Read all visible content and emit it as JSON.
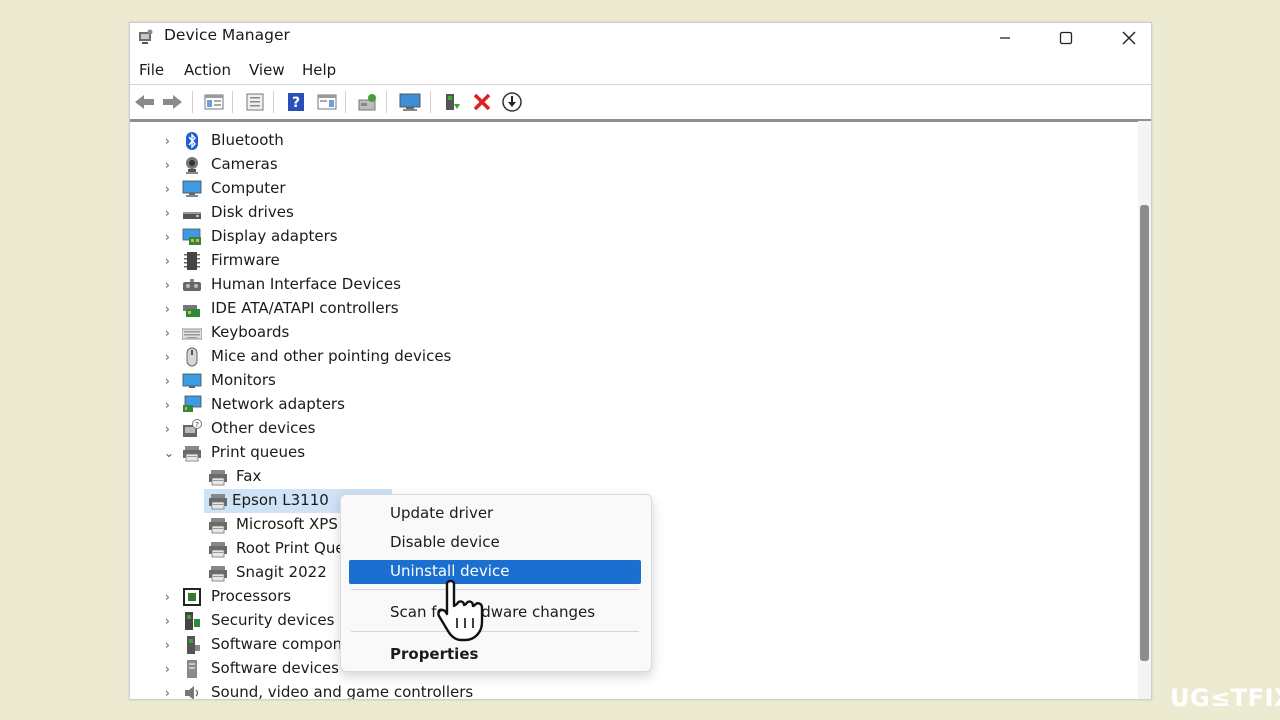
{
  "window": {
    "title": "Device Manager",
    "controls": [
      "minimize",
      "maximize",
      "close"
    ]
  },
  "menu": [
    "File",
    "Action",
    "View",
    "Help"
  ],
  "toolbar": {
    "icons": [
      "back-icon",
      "forward-icon",
      "console-tree-icon",
      "properties-icon",
      "help-icon",
      "action-pane-icon",
      "scan-hardware-icon",
      "monitor-icon",
      "update-driver-icon",
      "uninstall-icon",
      "download-icon"
    ]
  },
  "tree": {
    "items": [
      {
        "label": "Bluetooth",
        "icon": "bluetooth-icon",
        "expanded": false
      },
      {
        "label": "Cameras",
        "icon": "camera-icon",
        "expanded": false
      },
      {
        "label": "Computer",
        "icon": "computer-icon",
        "expanded": false
      },
      {
        "label": "Disk drives",
        "icon": "disk-icon",
        "expanded": false
      },
      {
        "label": "Display adapters",
        "icon": "display-adapter-icon",
        "expanded": false
      },
      {
        "label": "Firmware",
        "icon": "firmware-icon",
        "expanded": false
      },
      {
        "label": "Human Interface Devices",
        "icon": "hid-icon",
        "expanded": false
      },
      {
        "label": "IDE ATA/ATAPI controllers",
        "icon": "ide-icon",
        "expanded": false
      },
      {
        "label": "Keyboards",
        "icon": "keyboard-icon",
        "expanded": false
      },
      {
        "label": "Mice and other pointing devices",
        "icon": "mouse-icon",
        "expanded": false
      },
      {
        "label": "Monitors",
        "icon": "monitor-icon",
        "expanded": false
      },
      {
        "label": "Network adapters",
        "icon": "network-icon",
        "expanded": false
      },
      {
        "label": "Other devices",
        "icon": "other-devices-icon",
        "expanded": false
      },
      {
        "label": "Print queues",
        "icon": "printer-icon",
        "expanded": true
      },
      {
        "label": "Fax",
        "icon": "printer-icon",
        "child": true
      },
      {
        "label": "Epson L3110",
        "icon": "printer-icon",
        "child": true,
        "selected": true
      },
      {
        "label": "Microsoft XPS I",
        "icon": "printer-icon",
        "child": true
      },
      {
        "label": "Root Print Que",
        "icon": "printer-icon",
        "child": true
      },
      {
        "label": "Snagit 2022",
        "icon": "printer-icon",
        "child": true
      },
      {
        "label": "Processors",
        "icon": "processor-icon",
        "expanded": false
      },
      {
        "label": "Security devices",
        "icon": "security-icon",
        "expanded": false
      },
      {
        "label": "Software compone",
        "icon": "software-component-icon",
        "expanded": false
      },
      {
        "label": "Software devices",
        "icon": "software-device-icon",
        "expanded": false
      },
      {
        "label": "Sound, video and game controllers",
        "icon": "sound-icon",
        "expanded": false
      }
    ]
  },
  "context_menu": {
    "items": [
      {
        "label": "Update driver"
      },
      {
        "label": "Disable device"
      },
      {
        "label": "Uninstall device",
        "highlighted": true
      },
      {
        "label": "Scan for hardware changes"
      },
      {
        "label": "Properties",
        "bold": true
      }
    ]
  },
  "watermark": "UG≤TFIX",
  "colors": {
    "background": "#ecebd2",
    "selection": "#cfe3f6",
    "menu_highlight": "#1a6fd1",
    "uninstall_red": "#e02020"
  }
}
